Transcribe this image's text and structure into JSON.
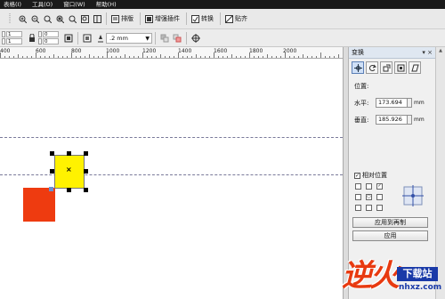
{
  "menubar": {
    "items": [
      "表格(I)",
      "工具(O)",
      "窗口(W)",
      "帮助(H)"
    ]
  },
  "toolbar1": {
    "paste_label": "排版",
    "plugin_label": "增强插件",
    "convert_label": "转换",
    "paste2_label": "贴齐"
  },
  "toolbar2": {
    "spin_top_left": "1",
    "spin_bottom_left": "1",
    "spin_top_right": "0",
    "spin_bottom_right": "0",
    "outline_width": ".2 mm"
  },
  "ruler": {
    "labels": [
      "400",
      "600",
      "800",
      "1000",
      "1200",
      "1400",
      "1600",
      "1800",
      "2000"
    ]
  },
  "docker": {
    "title": "变换",
    "close_glyph": "▾ ×",
    "position_title": "位置:",
    "h_label": "水平:",
    "h_value": "173.694",
    "v_label": "垂直:",
    "v_value": "185.926",
    "unit": "mm",
    "relative_label": "相对位置",
    "relative_checked": true,
    "apply_dup_label": "应用到再制",
    "apply_label": "应用"
  },
  "colors": {
    "red_object": "#ee3b10",
    "yellow_object": "#fff200",
    "accent": "#5b7fb6"
  },
  "watermark": {
    "logo": "逆火",
    "box_text": "下载站",
    "url": "nhxz.com"
  }
}
